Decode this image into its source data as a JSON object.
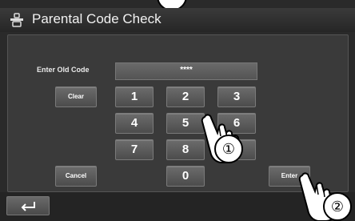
{
  "title": "Parental Code Check",
  "code": {
    "label": "Enter Old Code",
    "value": "****"
  },
  "keypad": {
    "clear": "Clear",
    "cancel": "Cancel",
    "enter": "Enter",
    "k1": "1",
    "k2": "2",
    "k3": "3",
    "k4": "4",
    "k5": "5",
    "k6": "6",
    "k7": "7",
    "k8": "8",
    "k9": "9",
    "k0": "0"
  },
  "callouts": {
    "step1": "①",
    "step2": "②"
  },
  "icons": {
    "title": "parental-lock-icon",
    "back": "back-arrow-icon"
  },
  "colors": {
    "background": "#2a2a2a",
    "key": "#5c5c5c",
    "text": "#ffffff"
  }
}
